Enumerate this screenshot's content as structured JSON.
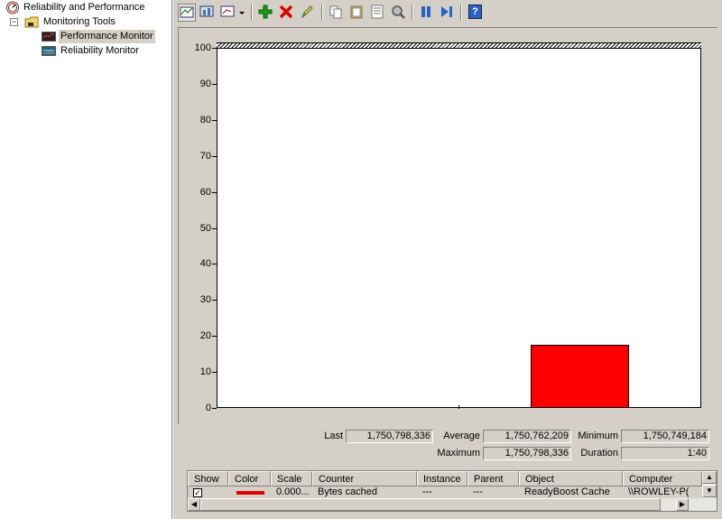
{
  "tree": {
    "root_label": "Reliability and Performance",
    "monitoring_tools_label": "Monitoring Tools",
    "expander_symbol": "−",
    "performance_monitor_label": "Performance Monitor",
    "reliability_monitor_label": "Reliability Monitor"
  },
  "toolbar": {
    "buttons": [
      "view-graph-icon",
      "view-current-activity-icon",
      "change-graph-type-icon",
      "dropdown-arrow-icon",
      "add-counter-icon",
      "delete-counter-icon",
      "highlight-icon",
      "copy-properties-icon",
      "paste-counter-list-icon",
      "properties-icon",
      "zoom-icon",
      "freeze-display-icon",
      "update-data-icon",
      "help-icon"
    ],
    "help_glyph": "?"
  },
  "chart_data": {
    "type": "bar",
    "ylim": [
      0,
      100
    ],
    "yticks": [
      "0",
      "10",
      "20",
      "30",
      "40",
      "50",
      "60",
      "70",
      "80",
      "90",
      "100"
    ],
    "series": [
      {
        "values": [
          17.5
        ],
        "color": "#ff0000"
      }
    ]
  },
  "stats": {
    "last_label": "Last",
    "last_value": "1,750,798,336",
    "average_label": "Average",
    "average_value": "1,750,762,209",
    "minimum_label": "Minimum",
    "minimum_value": "1,750,749,184",
    "maximum_label": "Maximum",
    "maximum_value": "1,750,798,336",
    "duration_label": "Duration",
    "duration_value": "1:40"
  },
  "table": {
    "headers": {
      "show": "Show",
      "color": "Color",
      "scale": "Scale",
      "counter": "Counter",
      "instance": "Instance",
      "parent": "Parent",
      "object": "Object",
      "computer": "Computer"
    },
    "row": {
      "checked_glyph": "✓",
      "color_hex": "#e00000",
      "scale": "0.000...",
      "counter": "Bytes cached",
      "instance": "---",
      "parent": "---",
      "object": "ReadyBoost Cache",
      "computer": "\\\\ROWLEY-P("
    },
    "scroll_left": "◀",
    "scroll_right": "▶",
    "scroll_up": "▲",
    "scroll_down": "▼"
  }
}
